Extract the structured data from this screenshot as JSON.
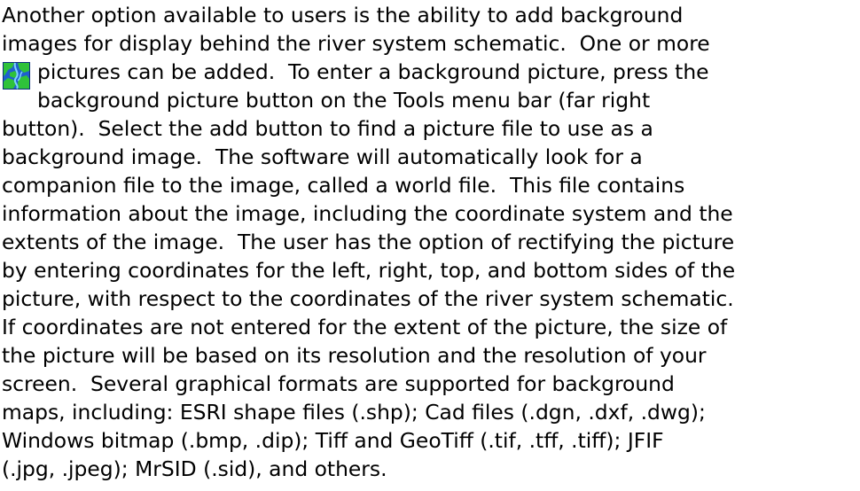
{
  "document": {
    "lines": [
      "Another option available to users is the ability to add background",
      "images for display behind the river system schematic.  One or more",
      "pictures can be added.  To enter a background picture, press the",
      "background picture button on the Tools menu bar (far right",
      "button).  Select the add button to find a picture file to use as a",
      "background image.  The software will automatically look for a",
      "companion file to the image, called a world file.  This file contains",
      "information about the image, including the coordinate system and the",
      "extents of the image.  The user has the option of rectifying the picture",
      "by entering coordinates for the left, right, top, and bottom sides of the",
      "picture, with respect to the coordinates of the river system schematic.",
      "If coordinates are not entered for the extent of the picture, the size of",
      "the picture will be based on its resolution and the resolution of your",
      "screen.  Several graphical formats are supported for background",
      "maps, including: ESRI shape files (.shp); Cad files (.dgn, .dxf, .dwg);",
      "Windows bitmap (.bmp, .dip); Tiff and GeoTiff (.tif, .tff, .tiff); JFIF",
      "(.jpg, .jpeg); MrSID (.sid), and others."
    ],
    "icon": "background-picture-icon"
  }
}
